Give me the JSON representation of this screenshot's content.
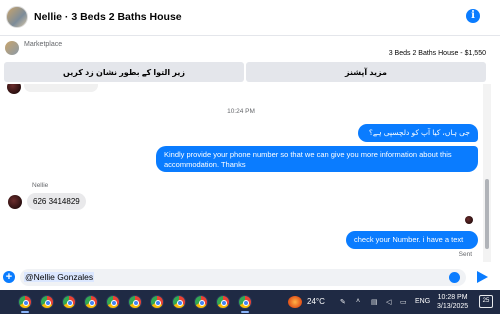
{
  "header": {
    "title": "Nellie · 3 Beds 2 Baths House",
    "info_icon": "i"
  },
  "marketplace": {
    "label": "Marketplace",
    "listing": "3 Beds 2 Baths House - $1,550"
  },
  "actions": {
    "more_options": "مزید آپشنز",
    "mark_pending": "زیر التوا کے بطور نشان زد کریں"
  },
  "chat": {
    "timestamp": "10:24 PM",
    "messages": [
      {
        "dir": "out",
        "text": "جی ہاں، کیا آپ کو دلچسپی ہے؟"
      },
      {
        "dir": "out",
        "text": "Kindly provide your phone number so that we can give you more information about this accommodation. Thanks"
      },
      {
        "dir": "in",
        "sender": "Nellie",
        "text": "626 3414829"
      },
      {
        "dir": "out",
        "text": "check your Number. i have a text"
      }
    ],
    "status": "Sent"
  },
  "composer": {
    "value": "@Nellie Gonzales"
  },
  "taskbar": {
    "temperature": "24°C",
    "language": "ENG",
    "time": "10:28 PM",
    "date": "3/13/2025",
    "notifications": "25"
  },
  "colors": {
    "accent": "#0a7cff",
    "incoming_bubble": "#e9e9eb",
    "taskbar": "#1f2a44"
  }
}
